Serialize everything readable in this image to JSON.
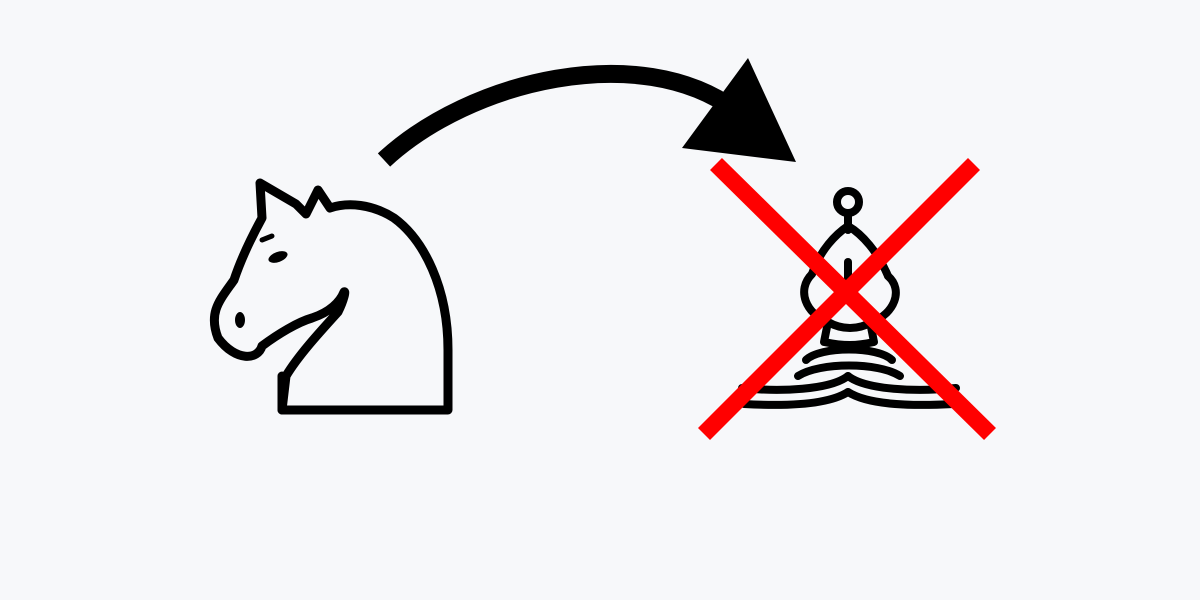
{
  "diagram": {
    "background_color": "#f7f8fa",
    "ink_color": "#000000",
    "cross_color": "#ff0000",
    "elements": [
      {
        "kind": "chess-piece",
        "piece": "knight",
        "color": "white",
        "icon": "knight-icon"
      },
      {
        "kind": "arrow",
        "shape": "curved",
        "direction": "knight-to-bishop",
        "icon": "curved-arrow-icon"
      },
      {
        "kind": "chess-piece",
        "piece": "bishop",
        "color": "white",
        "icon": "bishop-icon"
      },
      {
        "kind": "mark",
        "symbol": "x",
        "meaning": "crossed-out",
        "icon": "cross-mark-icon"
      }
    ]
  }
}
